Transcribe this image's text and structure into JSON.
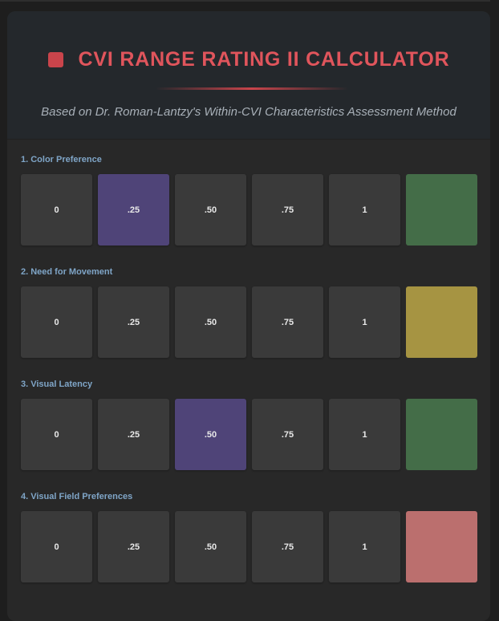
{
  "header": {
    "icon": "red-square-icon",
    "title": "CVI RANGE RATING II CALCULATOR",
    "subtitle": "Based on Dr. Roman-Lantzy's Within-CVI Characteristics Assessment Method"
  },
  "colors": {
    "accent": "#e0555c",
    "selected": "#4f4478",
    "option_bg": "#3a3a3a",
    "label": "#7fa5c7"
  },
  "sections": [
    {
      "label": "1. Color Preference",
      "options": [
        "0",
        ".25",
        ".50",
        ".75",
        "1"
      ],
      "selected_index": 1,
      "indicator_color": "#446d48"
    },
    {
      "label": "2. Need for Movement",
      "options": [
        "0",
        ".25",
        ".50",
        ".75",
        "1"
      ],
      "selected_index": -1,
      "indicator_color": "#a69442"
    },
    {
      "label": "3. Visual Latency",
      "options": [
        "0",
        ".25",
        ".50",
        ".75",
        "1"
      ],
      "selected_index": 2,
      "indicator_color": "#446d48"
    },
    {
      "label": "4. Visual Field Preferences",
      "options": [
        "0",
        ".25",
        ".50",
        ".75",
        "1"
      ],
      "selected_index": -1,
      "indicator_color": "#bb6f6e"
    }
  ]
}
